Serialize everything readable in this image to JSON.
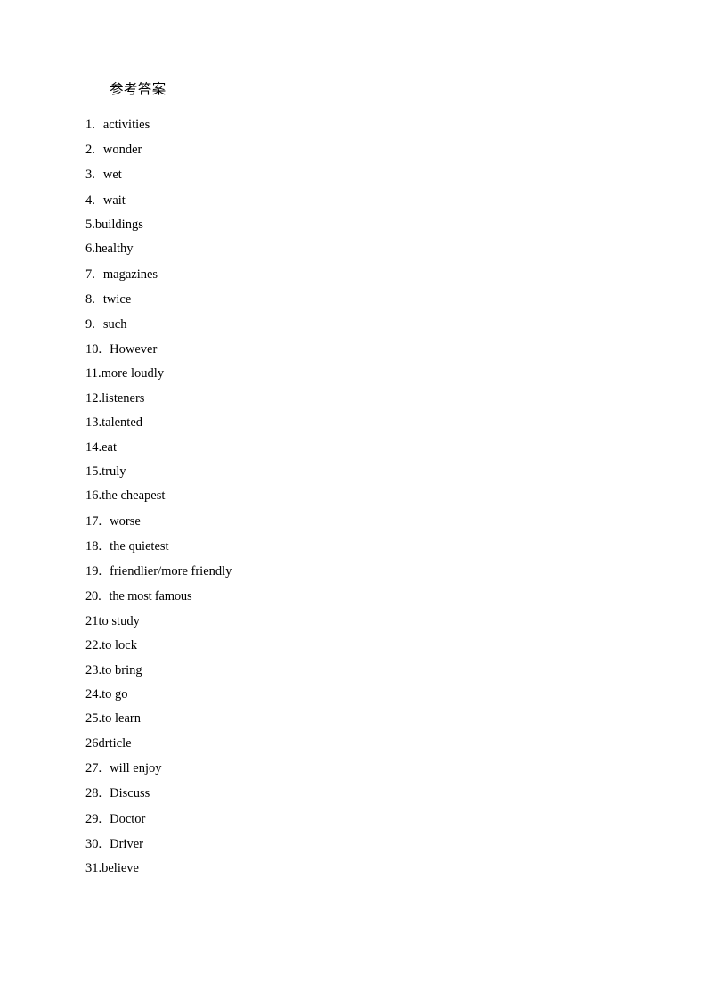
{
  "document": {
    "title": "参考答案",
    "background_color": "#ffffff",
    "text_color": "#000000"
  },
  "answers": [
    {
      "number": "1.",
      "separator": "wide",
      "text": "activities"
    },
    {
      "number": "2.",
      "separator": "wide",
      "text": "wonder"
    },
    {
      "number": "3.",
      "separator": "wide",
      "text": "wet"
    },
    {
      "number": "4.",
      "separator": "wide",
      "text": "wait"
    },
    {
      "number": "5.",
      "separator": "tight",
      "text": "buildings"
    },
    {
      "number": "6.",
      "separator": "tight",
      "text": "healthy"
    },
    {
      "number": "7.",
      "separator": "wide",
      "text": "magazines"
    },
    {
      "number": "8.",
      "separator": "wide",
      "text": "twice"
    },
    {
      "number": "9.",
      "separator": "wide",
      "text": "such"
    },
    {
      "number": "10.",
      "separator": "wide",
      "text": "However"
    },
    {
      "number": "11.",
      "separator": "tight",
      "text": "more loudly"
    },
    {
      "number": "12.",
      "separator": "tight",
      "text": "listeners"
    },
    {
      "number": "13.",
      "separator": "tight",
      "text": "talented"
    },
    {
      "number": "14.",
      "separator": "tight",
      "text": "eat"
    },
    {
      "number": "15.",
      "separator": "tight",
      "text": "truly"
    },
    {
      "number": "16.",
      "separator": "tight",
      "text": "the cheapest"
    },
    {
      "number": "17.",
      "separator": "wide",
      "text": "worse"
    },
    {
      "number": "18.",
      "separator": "wide",
      "text": "the quietest"
    },
    {
      "number": "19.",
      "separator": "wide",
      "text": "friendlier/more friendly"
    },
    {
      "number": "20.",
      "separator": "wide",
      "text": "the most famous"
    },
    {
      "number": "21",
      "separator": "tight",
      "text": "to study"
    },
    {
      "number": "22.",
      "separator": "tight",
      "text": "to lock"
    },
    {
      "number": "23.",
      "separator": "tight",
      "text": "to bring"
    },
    {
      "number": "24.",
      "separator": "tight",
      "text": "to go"
    },
    {
      "number": "25.",
      "separator": "tight",
      "text": "to learn"
    },
    {
      "number": "26",
      "separator": "tight",
      "text": "drticle"
    },
    {
      "number": "27.",
      "separator": "wide",
      "text": "will enjoy"
    },
    {
      "number": "28.",
      "separator": "wide",
      "text": "Discuss"
    },
    {
      "number": "29.",
      "separator": "wide",
      "text": "Doctor"
    },
    {
      "number": "30.",
      "separator": "wide",
      "text": "Driver"
    },
    {
      "number": "31.",
      "separator": "tight",
      "text": "believe"
    }
  ]
}
